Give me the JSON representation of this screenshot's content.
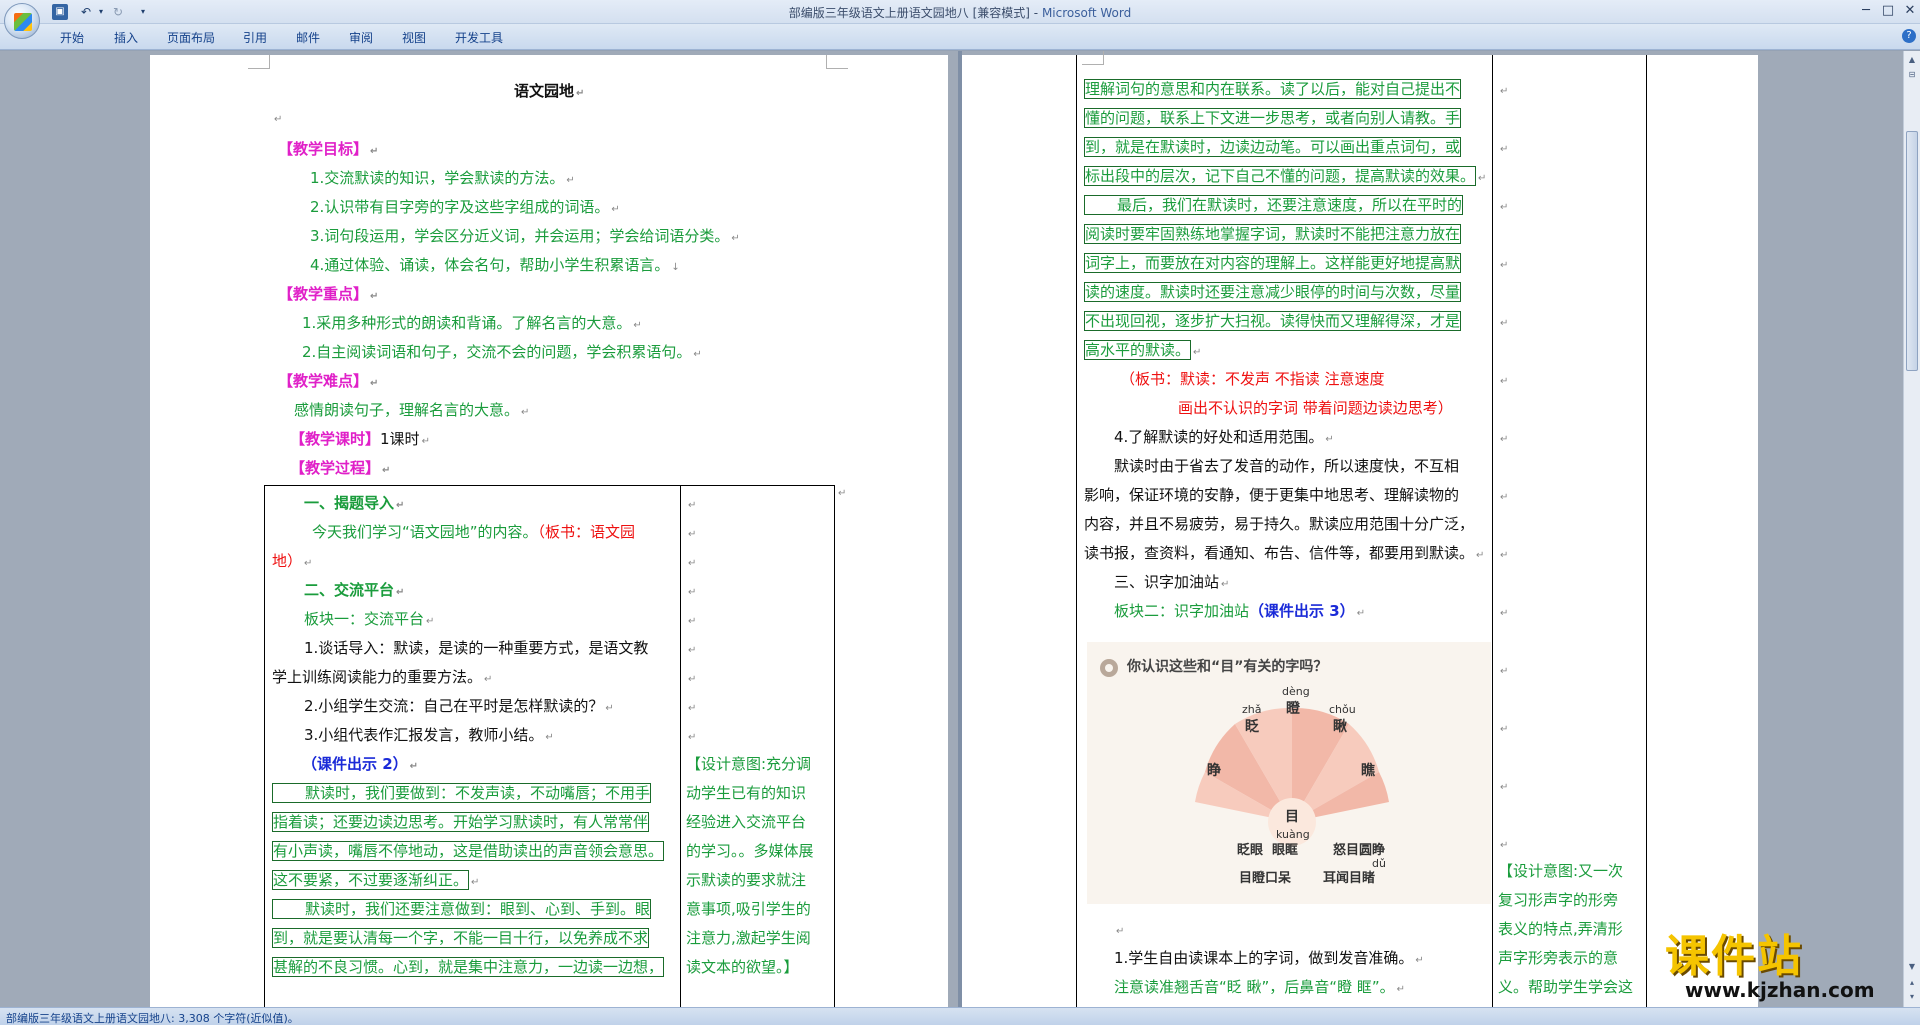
{
  "window": {
    "title": "部编版三年级语文上册语文园地八 [兼容模式]",
    "app_name": "Microsoft Word"
  },
  "quick_access": {
    "save_icon": "save-icon",
    "undo_icon": "undo-icon",
    "redo_icon": "redo-icon"
  },
  "ribbon_tabs": [
    "开始",
    "插入",
    "页面布局",
    "引用",
    "邮件",
    "审阅",
    "视图",
    "开发工具"
  ],
  "page1": {
    "title": "语文园地",
    "goals_heading": "【教学目标】",
    "goals": [
      "1.交流默读的知识，学会默读的方法。",
      "2.认识带有目字旁的字及这些字组成的词语。",
      "3.词句段运用，学会区分近义词，并会运用；学会给词语分类。",
      "4.通过体验、诵读，体会名句，帮助小学生积累语言。"
    ],
    "key_heading": "【教学重点】",
    "key_points": [
      "1.采用多种形式的朗读和背诵。了解名言的大意。",
      "2.自主阅读词语和句子，交流不会的问题，学会积累语句。"
    ],
    "diff_heading": "【教学难点】",
    "diff_text": "感情朗读句子，理解名言的大意。",
    "hours_heading": "【教学课时】",
    "hours_text": "1课时",
    "process_heading": "【教学过程】",
    "table": {
      "s1_heading": "一、揭题导入",
      "s1_text_a": "今天我们学习“语文园地”的内容。",
      "s1_board_a": "（板书：语文园",
      "s1_board_b": "地）",
      "s2_heading": "二、交流平台",
      "block1": "板块一：交流平台",
      "item1_a": "1.谈话导入：默读，是读的一种重要方式，是语文教",
      "item1_b": "学上训练阅读能力的重要方法。",
      "item2": "2.小组学生交流：自己在平时是怎样默读的？",
      "item3": "3.小组代表作汇报发言，教师小结。",
      "courseware2": "（课件出示 2）",
      "box1": [
        "默读时，我们要做到：不发声读，不动嘴唇；不用手",
        "指着读；还要边读边思考。开始学习默读时，有人常常伴",
        "有小声读，嘴唇不停地动，这是借助读出的声音领会意思。",
        "这不要紧，不过要逐渐纠正。"
      ],
      "box2": [
        "默读时，我们还要注意做到：眼到、心到、手到。眼",
        "到，就是要认清每一个字，不能一目十行，以免养成不求",
        "甚解的不良习惯。心到，就是集中注意力，一边读一边想，"
      ],
      "design_note": [
        "【设计意图:充分调",
        "动学生已有的知识",
        "经验进入交流平台",
        "的学习。。多媒体展",
        "示默读的要求就注",
        "意事项,吸引学生的",
        "注意力,激起学生阅",
        "读文本的欲望。】"
      ]
    }
  },
  "page2": {
    "box_lines": [
      "理解词句的意思和内在联系。读了以后，能对自己提出不",
      "懂的问题，联系上下文进一步思考，或者向别人请教。手",
      "到，就是在默读时，边读边动笔。可以画出重点词句，或",
      "标出段中的层次，记下自己不懂的问题，提高默读的效果。"
    ],
    "box2_lines": [
      "最后，我们在默读时，还要注意速度，所以在平时的",
      "阅读时要牢固熟练地掌握字词，默读时不能把注意力放在",
      "词字上，而要放在对内容的理解上。这样能更好地提高默",
      "读的速度。默读时还要注意减少眼停的时间与次数，尽量",
      "不出现回视，逐步扩大扫视。读得快而又理解得深，才是",
      "高水平的默读。"
    ],
    "board_line1": "（板书：默读：不发声   不指读   注意速度",
    "board_line2": "画出不认识的字词   带着问题边读边思考）",
    "item4": "4.了解默读的好处和适用范围。",
    "para": [
      "默读时由于省去了发音的动作，所以速度快，不互相",
      "影响，保证环境的安静，便于更集中地思考、理解读物的",
      "内容，并且不易疲劳，易于持久。默读应用范围十分广泛，",
      "读书报，查资料，看通知、布告、信件等，都要用到默读。"
    ],
    "s3_heading": "三、识字加油站",
    "block2": "板块二：识字加油站",
    "courseware3": "（课件出示 3）",
    "image": {
      "question": "你认识这些和“目”有关的字吗？",
      "center": "目",
      "chars": [
        "眨",
        "瞪",
        "瞅",
        "睁",
        "瞧"
      ],
      "pinyin": [
        "zhǎ",
        "dèng",
        "chǒu"
      ],
      "bottom_pinyin_1": "kuàng",
      "words_row1": [
        "眨眼",
        "眼眶",
        "怒目圆睁"
      ],
      "bottom_pinyin_2": "dǔ",
      "words_row2": [
        "目瞪口呆",
        "耳闻目睹"
      ]
    },
    "after1": "1.学生自由读课本上的字词，做到发音准确。",
    "after2": "注意读准翘舌音“眨  瞅”，后鼻音“瞪  眶”。",
    "design_note": [
      "【设计意图:又一次",
      "复习形声字的形旁",
      "表义的特点,弄清形",
      "声字形旁表示的意",
      "义。帮助学生学会这"
    ]
  },
  "status": "部编版三年级语文上册语文园地八: 3,308 个字符(近似值)。",
  "watermark": {
    "text": "课件站",
    "url": "www.kjzhan.com"
  },
  "colors": {
    "magenta": "#e020c8",
    "green": "#1a9c3c",
    "red": "#ee1111",
    "blue": "#1a2ad8"
  }
}
